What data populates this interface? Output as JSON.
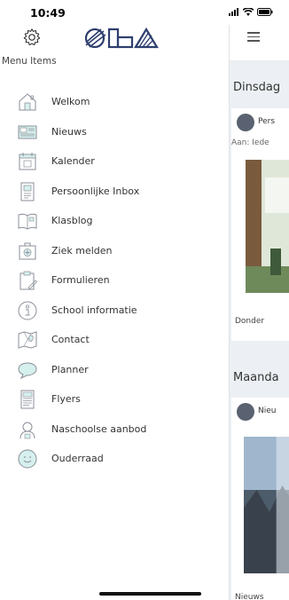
{
  "status_bar": {
    "time": "10:49"
  },
  "drawer": {
    "title": "Menu Items",
    "items": [
      {
        "label": "Welkom",
        "icon": "house-icon"
      },
      {
        "label": "Nieuws",
        "icon": "newspaper-icon"
      },
      {
        "label": "Kalender",
        "icon": "calendar-icon"
      },
      {
        "label": "Persoonlijke Inbox",
        "icon": "inbox-icon"
      },
      {
        "label": "Klasblog",
        "icon": "book-icon"
      },
      {
        "label": "Ziek melden",
        "icon": "medical-kit-icon"
      },
      {
        "label": "Formulieren",
        "icon": "clipboard-icon"
      },
      {
        "label": "School informatie",
        "icon": "info-icon"
      },
      {
        "label": "Contact",
        "icon": "map-icon"
      },
      {
        "label": "Planner",
        "icon": "chat-bubble-icon"
      },
      {
        "label": "Flyers",
        "icon": "document-icon"
      },
      {
        "label": "Naschoolse aanbod",
        "icon": "person-icon"
      },
      {
        "label": "Ouderraad",
        "icon": "smiley-icon"
      }
    ]
  },
  "main": {
    "sections": [
      {
        "header": "Dinsdag",
        "sender": "Pers",
        "to": "Aan: Iede",
        "footer": "Donder"
      },
      {
        "header": "Maanda",
        "sender": "Nieu",
        "footer": "Nieuws"
      }
    ]
  },
  "colors": {
    "accent": "#2e3f6e",
    "icon_line": "#8a8f98",
    "icon_fill": "#d6f0ee",
    "background": "#eceff3"
  }
}
